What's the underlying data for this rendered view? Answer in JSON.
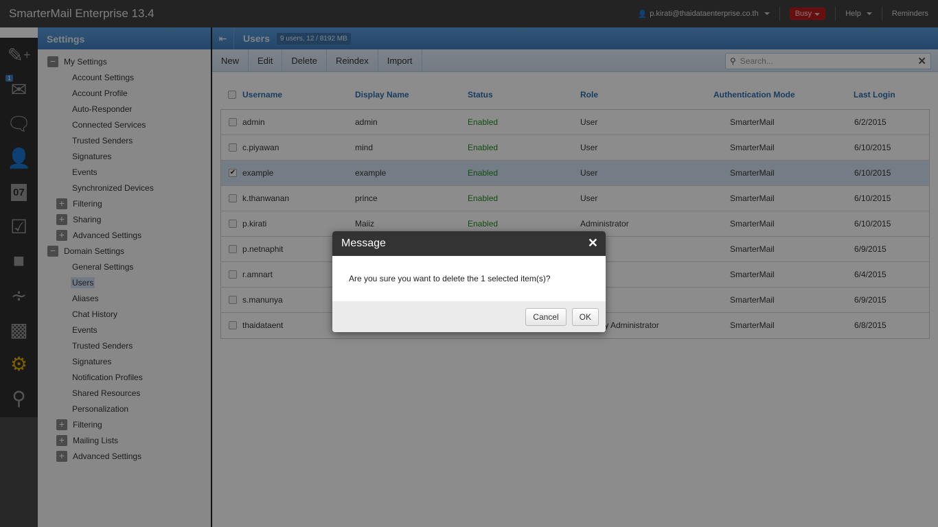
{
  "app": {
    "title": "SmarterMail Enterprise 13.4"
  },
  "topnav": {
    "user": "p.kirati@thaidataenterprise.co.th",
    "status": "Busy",
    "help": "Help",
    "reminders": "Reminders",
    "status_color": "#c01a1a"
  },
  "iconbar": {
    "items": [
      {
        "icon": "compose-icon"
      },
      {
        "icon": "mail-icon",
        "badge": "1"
      },
      {
        "icon": "chat-icon"
      },
      {
        "icon": "contacts-icon"
      },
      {
        "icon": "calendar-icon",
        "label": "07"
      },
      {
        "icon": "tasks-icon"
      },
      {
        "icon": "notes-icon"
      },
      {
        "icon": "rss-icon"
      },
      {
        "icon": "reports-icon"
      },
      {
        "icon": "settings-icon"
      },
      {
        "icon": "search-icon"
      }
    ]
  },
  "settings": {
    "title": "Settings",
    "my_settings": {
      "label": "My Settings",
      "items": [
        "Account Settings",
        "Account Profile",
        "Auto-Responder",
        "Connected Services",
        "Trusted Senders",
        "Signatures",
        "Events",
        "Synchronized Devices"
      ],
      "collapsed": [
        "Filtering",
        "Sharing",
        "Advanced Settings"
      ]
    },
    "domain_settings": {
      "label": "Domain Settings",
      "items": [
        "General Settings",
        "Users",
        "Aliases",
        "Chat History",
        "Events",
        "Trusted Senders",
        "Signatures",
        "Notification Profiles",
        "Shared Resources",
        "Personalization"
      ],
      "selected": "Users",
      "collapsed": [
        "Filtering",
        "Mailing Lists",
        "Advanced Settings"
      ]
    }
  },
  "main": {
    "title": "Users",
    "quota": "9 users, 12 / 8192 MB",
    "toolbar": [
      "New",
      "Edit",
      "Delete",
      "Reindex",
      "Import"
    ],
    "search_placeholder": "Search...",
    "columns": [
      "Username",
      "Display Name",
      "Status",
      "Role",
      "Authentication Mode",
      "Last Login"
    ],
    "rows": [
      {
        "username": "admin",
        "display": "admin",
        "status": "Enabled",
        "role": "User",
        "auth": "SmarterMail",
        "last": "6/2/2015",
        "checked": false
      },
      {
        "username": "c.piyawan",
        "display": "mind",
        "status": "Enabled",
        "role": "User",
        "auth": "SmarterMail",
        "last": "6/10/2015",
        "checked": false
      },
      {
        "username": "example",
        "display": "example",
        "status": "Enabled",
        "role": "User",
        "auth": "SmarterMail",
        "last": "6/10/2015",
        "checked": true
      },
      {
        "username": "k.thanwanan",
        "display": "prince",
        "status": "Enabled",
        "role": "User",
        "auth": "SmarterMail",
        "last": "6/10/2015",
        "checked": false
      },
      {
        "username": "p.kirati",
        "display": "Maiiz",
        "status": "Enabled",
        "role": "Administrator",
        "auth": "SmarterMail",
        "last": "6/10/2015",
        "checked": false
      },
      {
        "username": "p.netnaphit",
        "display": "",
        "status": "",
        "role": "",
        "auth": "SmarterMail",
        "last": "6/9/2015",
        "checked": false
      },
      {
        "username": "r.amnart",
        "display": "",
        "status": "",
        "role": "",
        "auth": "SmarterMail",
        "last": "6/4/2015",
        "checked": false
      },
      {
        "username": "s.manunya",
        "display": "",
        "status": "",
        "role": "",
        "auth": "SmarterMail",
        "last": "6/9/2015",
        "checked": false
      },
      {
        "username": "thaidataent",
        "display": "",
        "status": "",
        "role": "Primary Administrator",
        "auth": "SmarterMail",
        "last": "6/8/2015",
        "checked": false
      }
    ]
  },
  "dialog": {
    "title": "Message",
    "message": "Are you sure you want to delete the 1 selected item(s)?",
    "cancel": "Cancel",
    "ok": "OK"
  }
}
